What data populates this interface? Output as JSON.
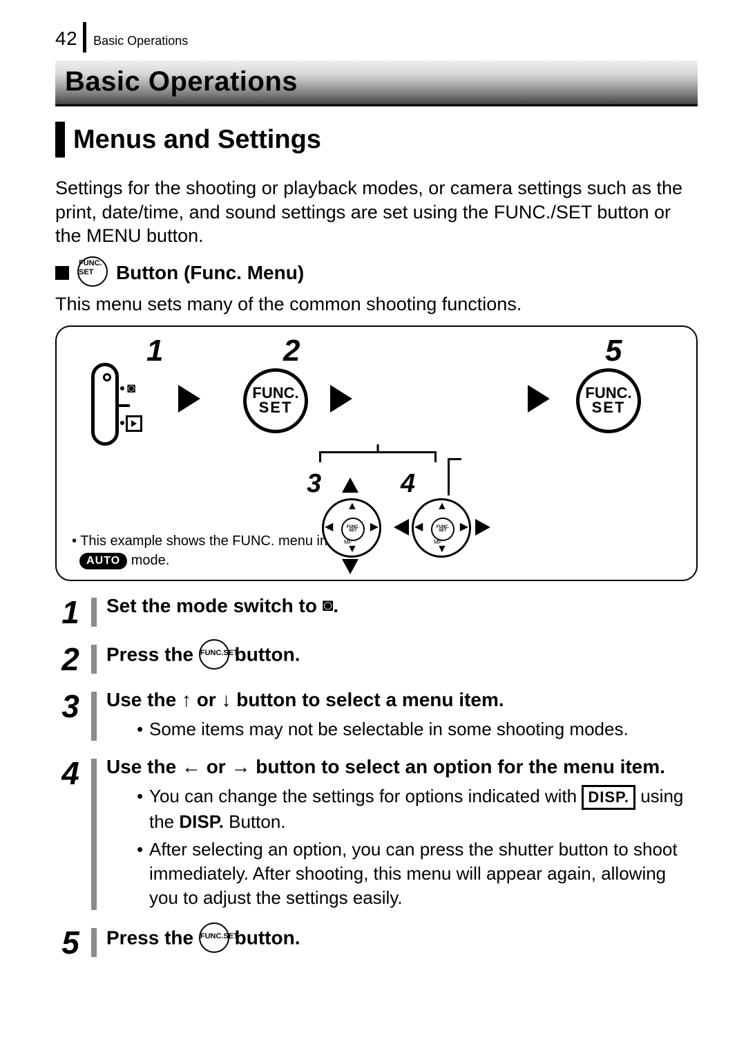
{
  "header": {
    "page_number": "42",
    "section": "Basic Operations"
  },
  "chapter_title": "Basic Operations",
  "section_title": "Menus and Settings",
  "intro_text": "Settings for the shooting or playback modes, or camera settings such as the print, date/time, and sound settings are set using the FUNC./SET button or the MENU button.",
  "subsection": {
    "icon_l1": "FUNC.",
    "icon_l2": "SET",
    "title": "Button (Func. Menu)"
  },
  "subsection_desc": "This menu sets many of the common shooting functions.",
  "diagram": {
    "numbers": {
      "n1": "1",
      "n2": "2",
      "n3": "3",
      "n4": "4",
      "n5": "5"
    },
    "func_l1": "FUNC.",
    "func_l2": "SET",
    "pad_inner_l1": "FUNC.",
    "pad_inner_l2": "SET",
    "pad_mf": "MF",
    "note_before": "This example shows the FUNC. menu in ",
    "note_badge": "AUTO",
    "note_after": " mode."
  },
  "steps": [
    {
      "n": "1",
      "title_before": "Set the mode switch to ",
      "title_after": "."
    },
    {
      "n": "2",
      "title_before": "Press the ",
      "title_after": " button.",
      "icon_l1": "FUNC.",
      "icon_l2": "SET"
    },
    {
      "n": "3",
      "title": "Use the ↑ or ↓ button to select a menu item.",
      "bullets": [
        "Some items may not be selectable in some shooting modes."
      ]
    },
    {
      "n": "4",
      "title": "Use the ← or → button to select an option for the menu item.",
      "bullets_rich": [
        {
          "before": "You can change the settings for options indicated with ",
          "badge": "DISP.",
          "after": " using the ",
          "bold": "DISP.",
          "after2": " Button."
        },
        {
          "plain": "After selecting an option, you can press the shutter button to shoot immediately. After shooting, this menu will appear again, allowing you to adjust the settings easily."
        }
      ]
    },
    {
      "n": "5",
      "title_before": "Press the ",
      "title_after": " button.",
      "icon_l1": "FUNC.",
      "icon_l2": "SET"
    }
  ]
}
